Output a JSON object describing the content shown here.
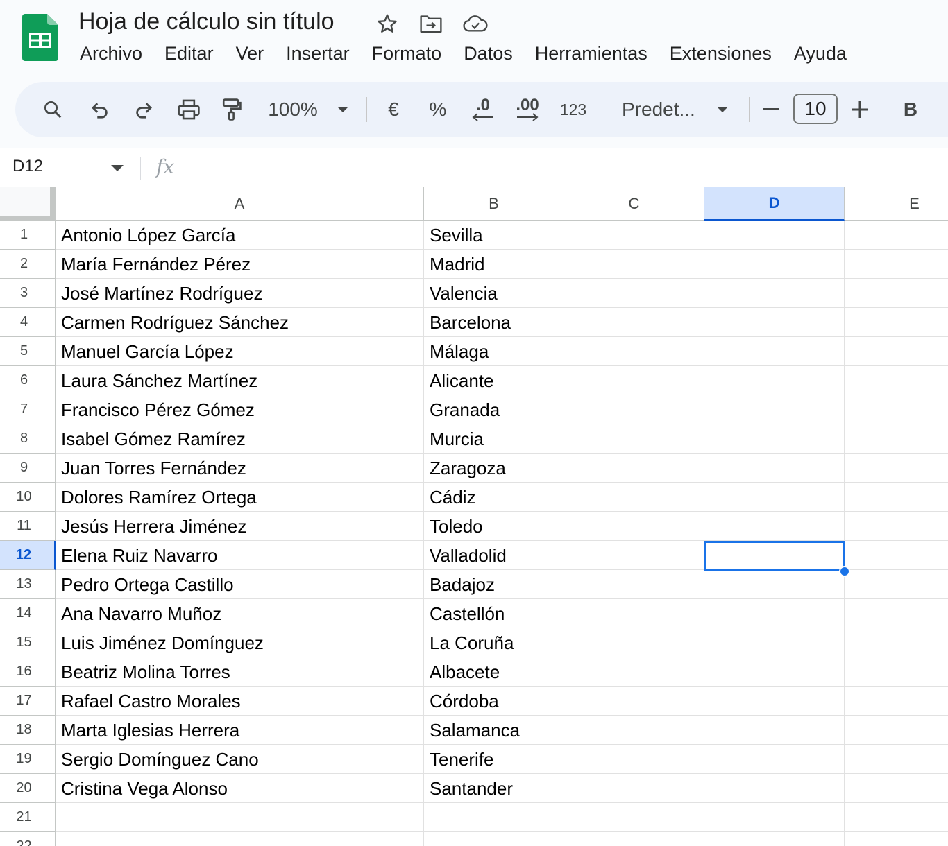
{
  "app": {
    "title": "Hoja de cálculo sin título",
    "brand_color": "#0f9d58",
    "icons": [
      "sheets-logo-icon",
      "star-icon",
      "move-folder-icon",
      "cloud-saved-icon"
    ]
  },
  "menu": [
    "Archivo",
    "Editar",
    "Ver",
    "Insertar",
    "Formato",
    "Datos",
    "Herramientas",
    "Extensiones",
    "Ayuda"
  ],
  "toolbar": {
    "zoom": "100%",
    "currency_label": "€",
    "percent_label": "%",
    "decrease_decimals_label": ".0",
    "increase_decimals_label": ".00",
    "more_formats_label": "123",
    "font": "Predet...",
    "font_size": "10",
    "bold_label": "B"
  },
  "formula_bar": {
    "name_box": "D12",
    "fx_label": "fx",
    "value": ""
  },
  "grid": {
    "columns": [
      "A",
      "B",
      "C",
      "D",
      "E"
    ],
    "selected_column": "D",
    "selected_row": "12",
    "selection_color": "#1a73e8",
    "row_numbers": [
      "1",
      "2",
      "3",
      "4",
      "5",
      "6",
      "7",
      "8",
      "9",
      "10",
      "11",
      "12",
      "13",
      "14",
      "15",
      "16",
      "17",
      "18",
      "19",
      "20",
      "21",
      "22"
    ],
    "rows": [
      [
        "Antonio López García",
        "Sevilla"
      ],
      [
        "María Fernández Pérez",
        "Madrid"
      ],
      [
        "José Martínez Rodríguez",
        "Valencia"
      ],
      [
        "Carmen Rodríguez Sánchez",
        "Barcelona"
      ],
      [
        "Manuel García López",
        "Málaga"
      ],
      [
        "Laura Sánchez Martínez",
        "Alicante"
      ],
      [
        "Francisco Pérez Gómez",
        "Granada"
      ],
      [
        "Isabel Gómez Ramírez",
        "Murcia"
      ],
      [
        "Juan Torres Fernández",
        "Zaragoza"
      ],
      [
        "Dolores Ramírez Ortega",
        "Cádiz"
      ],
      [
        "Jesús Herrera Jiménez",
        "Toledo"
      ],
      [
        "Elena Ruiz Navarro",
        "Valladolid"
      ],
      [
        "Pedro Ortega Castillo",
        "Badajoz"
      ],
      [
        "Ana Navarro Muñoz",
        "Castellón"
      ],
      [
        "Luis Jiménez Domínguez",
        "La Coruña"
      ],
      [
        "Beatriz Molina Torres",
        "Albacete"
      ],
      [
        "Rafael Castro Morales",
        "Córdoba"
      ],
      [
        "Marta Iglesias Herrera",
        "Salamanca"
      ],
      [
        "Sergio Domínguez Cano",
        "Tenerife"
      ],
      [
        "Cristina Vega Alonso",
        "Santander"
      ],
      [
        "",
        ""
      ],
      [
        "",
        ""
      ]
    ]
  }
}
